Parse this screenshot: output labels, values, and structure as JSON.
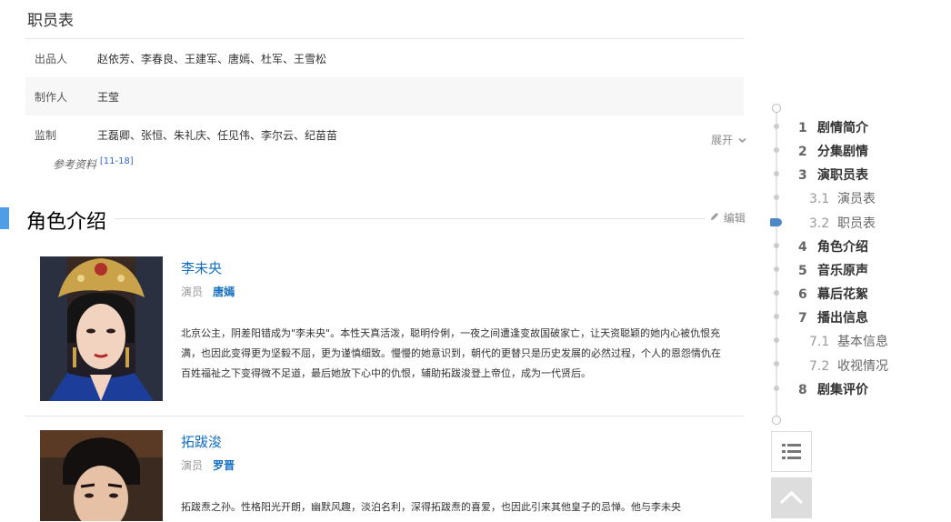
{
  "staff": {
    "title": "职员表",
    "rows": [
      {
        "label": "出品人",
        "value": "赵依芳、李春良、王建军、唐嫣、杜军、王雪松"
      },
      {
        "label": "制作人",
        "value": "王莹"
      },
      {
        "label": "监制",
        "value": "王磊卿、张恒、朱礼庆、任见伟、李尔云、纪苗苗"
      }
    ],
    "expand_label": "展开",
    "reference_label": "参考资料",
    "reference_sup": "[11-18]"
  },
  "section": {
    "title": "角色介绍",
    "edit_label": "编辑"
  },
  "roles": [
    {
      "name": "李未央",
      "actor_label": "演员",
      "actor": "唐嫣",
      "description": "北京公主，阴差阳错成为\"李未央\"。本性天真活泼，聪明伶俐，一夜之间遭逢变故国破家亡，让天资聪颖的她内心被仇恨充满，也因此变得更为坚毅不屈，更为谨慎细致。慢慢的她意识到，朝代的更替只是历史发展的必然过程，个人的恩怨情仇在百姓福祉之下变得微不足道，最后她放下心中的仇恨，辅助拓跋浚登上帝位，成为一代贤后。"
    },
    {
      "name": "拓跋浚",
      "actor_label": "演员",
      "actor": "罗晋",
      "description": "拓跋焘之孙。性格阳光开朗，幽默风趣，淡泊名利，深得拓跋焘的喜爱，也因此引来其他皇子的忌惮。他与李未央"
    }
  ],
  "toc": [
    {
      "num": "1",
      "label": "剧情简介",
      "level": 1
    },
    {
      "num": "2",
      "label": "分集剧情",
      "level": 1
    },
    {
      "num": "3",
      "label": "演职员表",
      "level": 1
    },
    {
      "num": "3.1",
      "label": "演员表",
      "level": 2
    },
    {
      "num": "3.2",
      "label": "职员表",
      "level": 2,
      "current": true
    },
    {
      "num": "4",
      "label": "角色介绍",
      "level": 1
    },
    {
      "num": "5",
      "label": "音乐原声",
      "level": 1
    },
    {
      "num": "6",
      "label": "幕后花絮",
      "level": 1
    },
    {
      "num": "7",
      "label": "播出信息",
      "level": 1
    },
    {
      "num": "7.1",
      "label": "基本信息",
      "level": 2
    },
    {
      "num": "7.2",
      "label": "收视情况",
      "level": 2
    },
    {
      "num": "8",
      "label": "剧集评价",
      "level": 1
    }
  ],
  "icons": {
    "expand": "chevron-down-icon",
    "edit": "pencil-icon",
    "list": "list-icon",
    "back_to_top": "chevron-up-icon"
  },
  "colors": {
    "accent": "#4e9de6",
    "link": "#136ec2",
    "current_marker": "#4e87c8"
  }
}
